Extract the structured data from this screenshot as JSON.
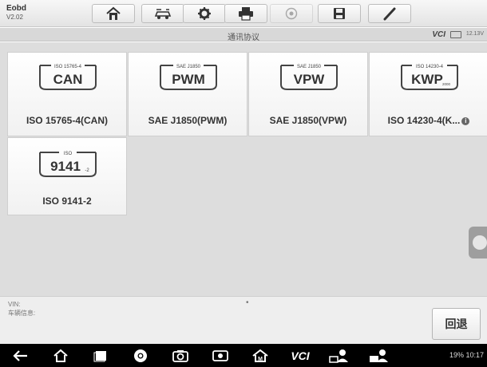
{
  "app": {
    "name": "Eobd",
    "version": "V2.02"
  },
  "toolbar": {
    "buttons": [
      {
        "id": "home",
        "icon": "home-icon"
      },
      {
        "id": "vehicle-swap",
        "icon": "car-swap-icon"
      },
      {
        "id": "settings",
        "icon": "gear-icon"
      },
      {
        "id": "print",
        "icon": "printer-icon"
      },
      {
        "id": "help",
        "icon": "help-icon",
        "disabled": true
      },
      {
        "id": "save",
        "icon": "save-icon"
      },
      {
        "id": "data-logging",
        "icon": "pen-icon"
      }
    ]
  },
  "status_strip": {
    "title": "通讯协议",
    "vci_label": "VCI",
    "voltage": "12.13V"
  },
  "protocols": [
    {
      "badge_top": "ISO 15765-4",
      "badge_main": "CAN",
      "label": "ISO 15765-4(CAN)"
    },
    {
      "badge_top": "SAE J1850",
      "badge_main": "PWM",
      "label": "SAE J1850(PWM)"
    },
    {
      "badge_top": "SAE J1850",
      "badge_main": "VPW",
      "label": "SAE J1850(VPW)"
    },
    {
      "badge_top": "ISO 14230-4",
      "badge_main": "KWP",
      "badge_sub": "2000",
      "label": "ISO 14230-4(K...",
      "info_glyph": "i"
    },
    {
      "badge_top": "ISO",
      "badge_main": "9141",
      "badge_sub": "-2",
      "label": "ISO 9141-2"
    }
  ],
  "bottom": {
    "vin_label": "VIN:",
    "vehicle_info_label": "车辆信息:",
    "dot": "•",
    "back_label": "回退"
  },
  "navbar": {
    "vcl_label": "VCI",
    "status_text": "19% 10:17",
    "items": [
      "back-arrow-icon",
      "home-outline-icon",
      "recent-apps-icon",
      "chrome-icon",
      "camera-icon",
      "screen-record-icon",
      "maxisys-home-icon",
      "vci-icon",
      "remote-expert-icon",
      "remote-desktop-icon"
    ]
  },
  "colors": {
    "toolbar": "#e9e9e9",
    "strip": "#d8d8d8",
    "main_bg": "#dddddd",
    "tile": "#f7f7f7",
    "navbar": "#000000"
  }
}
